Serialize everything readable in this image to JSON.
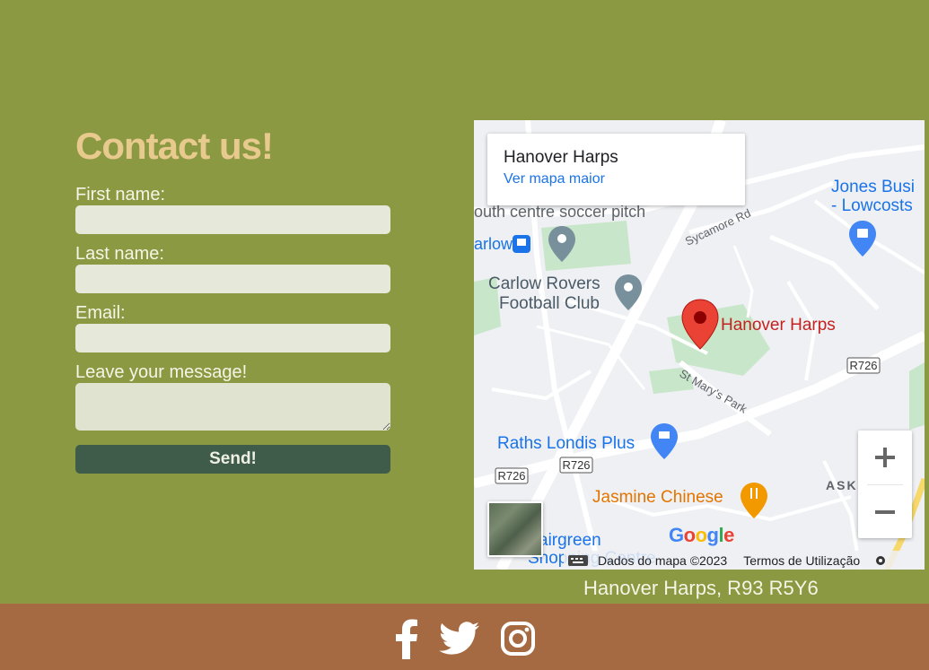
{
  "contact_form": {
    "title": "Contact us!",
    "fields": [
      {
        "label": "First name:",
        "value": "",
        "placeholder": ""
      },
      {
        "label": "Last name:",
        "value": "",
        "placeholder": ""
      },
      {
        "label": "Email:",
        "value": "",
        "placeholder": ""
      }
    ],
    "message_label": "Leave your message!",
    "message_value": "",
    "send_label": "Send!"
  },
  "map": {
    "place_name": "Hanover Harps",
    "view_larger_link": "Ver mapa maior",
    "zoom_in_symbol": "+",
    "zoom_out_symbol": "−",
    "attribution": "Dados do mapa ©2023",
    "terms": "Termos de Utilização",
    "google_logo": "Google",
    "labels": {
      "soccer_pitch": "outh centre soccer pitch",
      "carlow_bus": "arlow",
      "rovers_line1": "Carlow Rovers",
      "rovers_line2": "Football Club",
      "sycamore": "Sycamore Rd",
      "jones_line1": "Jones Busi",
      "jones_line2": "- Lowcosts",
      "pin_label": "Hanover Harps",
      "r726_east": "R726",
      "r726_mid": "R726",
      "r726_west": "R726",
      "st_marys": "St Mary's Park",
      "raths_londis": "Raths Londis Plus",
      "jasmine": "Jasmine Chinese",
      "askea": "ASKI",
      "fairgreen_line1": "airgreen",
      "fairgreen_line2": "Shopping Centre"
    },
    "colors": {
      "marker_red": "#ea4335",
      "poi_blue": "#4285f4",
      "poi_orange": "#e37400",
      "park_green": "#c8e6c9",
      "road_white": "#ffffff"
    }
  },
  "address": "Hanover Harps, R93 R5Y6",
  "social": {
    "facebook_icon": "facebook-icon",
    "twitter_icon": "twitter-icon",
    "instagram_icon": "instagram-icon"
  },
  "theme": {
    "page_bg": "#8b9a42",
    "title_color": "#e8c98e",
    "button_bg": "#3f5b4a",
    "footer_bg": "#a66a42"
  }
}
